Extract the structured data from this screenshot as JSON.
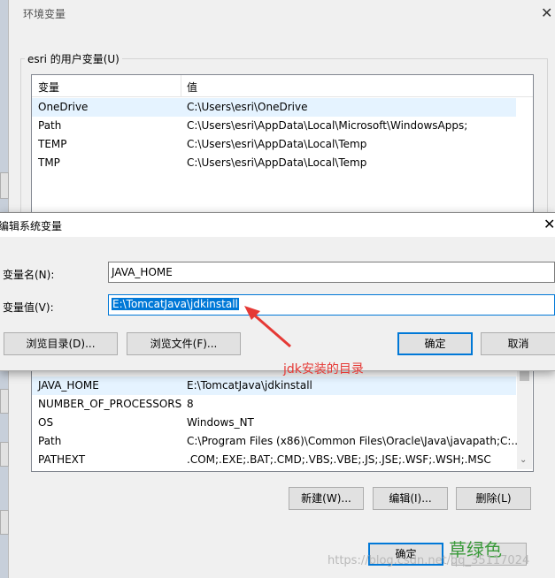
{
  "env_dialog": {
    "title": "环境变量",
    "user_group_label": "esri 的用户变量(U)",
    "columns": [
      "变量",
      "值"
    ],
    "user_vars": [
      {
        "name": "OneDrive",
        "value": "C:\\Users\\esri\\OneDrive"
      },
      {
        "name": "Path",
        "value": "C:\\Users\\esri\\AppData\\Local\\Microsoft\\WindowsApps;"
      },
      {
        "name": "TEMP",
        "value": "C:\\Users\\esri\\AppData\\Local\\Temp"
      },
      {
        "name": "TMP",
        "value": "C:\\Users\\esri\\AppData\\Local\\Temp"
      }
    ],
    "system_vars": [
      {
        "name": "JAVA_HOME",
        "value": "E:\\TomcatJava\\jdkinstall"
      },
      {
        "name": "NUMBER_OF_PROCESSORS",
        "value": "8"
      },
      {
        "name": "OS",
        "value": "Windows_NT"
      },
      {
        "name": "Path",
        "value": "C:\\Program Files (x86)\\Common Files\\Oracle\\Java\\javapath;C:..."
      },
      {
        "name": "PATHEXT",
        "value": ".COM;.EXE;.BAT;.CMD;.VBS;.VBE;.JS;.JSE;.WSF;.WSH;.MSC"
      }
    ],
    "new_label": "新建(W)...",
    "edit_label": "编辑(I)...",
    "delete_label": "删除(L)",
    "ok_label": "确定"
  },
  "edit_dialog": {
    "title": "编辑系统变量",
    "name_label": "变量名(N):",
    "name_value": "JAVA_HOME",
    "value_label": "变量值(V):",
    "value_value": "E:\\TomcatJava\\jdkinstall",
    "browse_dir_label": "浏览目录(D)...",
    "browse_file_label": "浏览文件(F)...",
    "ok_label": "确定",
    "cancel_label": "取消"
  },
  "annotation": {
    "text": "jdk安装的目录",
    "color": "#e53935"
  },
  "overlay": {
    "green_text": "草绿色",
    "watermark": "https://blog.csdn.net/qq_35117024"
  }
}
